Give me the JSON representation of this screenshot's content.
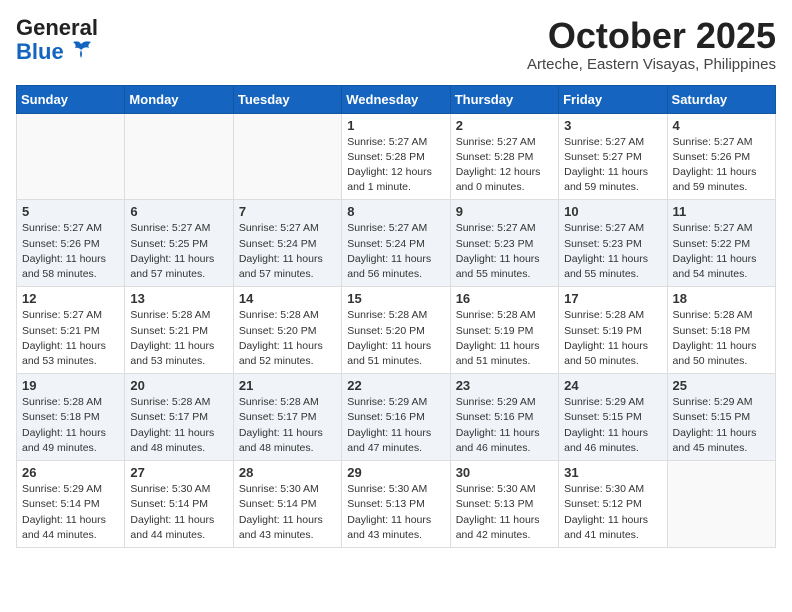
{
  "header": {
    "logo_general": "General",
    "logo_blue": "Blue",
    "month": "October 2025",
    "location": "Arteche, Eastern Visayas, Philippines"
  },
  "weekdays": [
    "Sunday",
    "Monday",
    "Tuesday",
    "Wednesday",
    "Thursday",
    "Friday",
    "Saturday"
  ],
  "weeks": [
    [
      {
        "day": "",
        "info": ""
      },
      {
        "day": "",
        "info": ""
      },
      {
        "day": "",
        "info": ""
      },
      {
        "day": "1",
        "info": "Sunrise: 5:27 AM\nSunset: 5:28 PM\nDaylight: 12 hours\nand 1 minute."
      },
      {
        "day": "2",
        "info": "Sunrise: 5:27 AM\nSunset: 5:28 PM\nDaylight: 12 hours\nand 0 minutes."
      },
      {
        "day": "3",
        "info": "Sunrise: 5:27 AM\nSunset: 5:27 PM\nDaylight: 11 hours\nand 59 minutes."
      },
      {
        "day": "4",
        "info": "Sunrise: 5:27 AM\nSunset: 5:26 PM\nDaylight: 11 hours\nand 59 minutes."
      }
    ],
    [
      {
        "day": "5",
        "info": "Sunrise: 5:27 AM\nSunset: 5:26 PM\nDaylight: 11 hours\nand 58 minutes."
      },
      {
        "day": "6",
        "info": "Sunrise: 5:27 AM\nSunset: 5:25 PM\nDaylight: 11 hours\nand 57 minutes."
      },
      {
        "day": "7",
        "info": "Sunrise: 5:27 AM\nSunset: 5:24 PM\nDaylight: 11 hours\nand 57 minutes."
      },
      {
        "day": "8",
        "info": "Sunrise: 5:27 AM\nSunset: 5:24 PM\nDaylight: 11 hours\nand 56 minutes."
      },
      {
        "day": "9",
        "info": "Sunrise: 5:27 AM\nSunset: 5:23 PM\nDaylight: 11 hours\nand 55 minutes."
      },
      {
        "day": "10",
        "info": "Sunrise: 5:27 AM\nSunset: 5:23 PM\nDaylight: 11 hours\nand 55 minutes."
      },
      {
        "day": "11",
        "info": "Sunrise: 5:27 AM\nSunset: 5:22 PM\nDaylight: 11 hours\nand 54 minutes."
      }
    ],
    [
      {
        "day": "12",
        "info": "Sunrise: 5:27 AM\nSunset: 5:21 PM\nDaylight: 11 hours\nand 53 minutes."
      },
      {
        "day": "13",
        "info": "Sunrise: 5:28 AM\nSunset: 5:21 PM\nDaylight: 11 hours\nand 53 minutes."
      },
      {
        "day": "14",
        "info": "Sunrise: 5:28 AM\nSunset: 5:20 PM\nDaylight: 11 hours\nand 52 minutes."
      },
      {
        "day": "15",
        "info": "Sunrise: 5:28 AM\nSunset: 5:20 PM\nDaylight: 11 hours\nand 51 minutes."
      },
      {
        "day": "16",
        "info": "Sunrise: 5:28 AM\nSunset: 5:19 PM\nDaylight: 11 hours\nand 51 minutes."
      },
      {
        "day": "17",
        "info": "Sunrise: 5:28 AM\nSunset: 5:19 PM\nDaylight: 11 hours\nand 50 minutes."
      },
      {
        "day": "18",
        "info": "Sunrise: 5:28 AM\nSunset: 5:18 PM\nDaylight: 11 hours\nand 50 minutes."
      }
    ],
    [
      {
        "day": "19",
        "info": "Sunrise: 5:28 AM\nSunset: 5:18 PM\nDaylight: 11 hours\nand 49 minutes."
      },
      {
        "day": "20",
        "info": "Sunrise: 5:28 AM\nSunset: 5:17 PM\nDaylight: 11 hours\nand 48 minutes."
      },
      {
        "day": "21",
        "info": "Sunrise: 5:28 AM\nSunset: 5:17 PM\nDaylight: 11 hours\nand 48 minutes."
      },
      {
        "day": "22",
        "info": "Sunrise: 5:29 AM\nSunset: 5:16 PM\nDaylight: 11 hours\nand 47 minutes."
      },
      {
        "day": "23",
        "info": "Sunrise: 5:29 AM\nSunset: 5:16 PM\nDaylight: 11 hours\nand 46 minutes."
      },
      {
        "day": "24",
        "info": "Sunrise: 5:29 AM\nSunset: 5:15 PM\nDaylight: 11 hours\nand 46 minutes."
      },
      {
        "day": "25",
        "info": "Sunrise: 5:29 AM\nSunset: 5:15 PM\nDaylight: 11 hours\nand 45 minutes."
      }
    ],
    [
      {
        "day": "26",
        "info": "Sunrise: 5:29 AM\nSunset: 5:14 PM\nDaylight: 11 hours\nand 44 minutes."
      },
      {
        "day": "27",
        "info": "Sunrise: 5:30 AM\nSunset: 5:14 PM\nDaylight: 11 hours\nand 44 minutes."
      },
      {
        "day": "28",
        "info": "Sunrise: 5:30 AM\nSunset: 5:14 PM\nDaylight: 11 hours\nand 43 minutes."
      },
      {
        "day": "29",
        "info": "Sunrise: 5:30 AM\nSunset: 5:13 PM\nDaylight: 11 hours\nand 43 minutes."
      },
      {
        "day": "30",
        "info": "Sunrise: 5:30 AM\nSunset: 5:13 PM\nDaylight: 11 hours\nand 42 minutes."
      },
      {
        "day": "31",
        "info": "Sunrise: 5:30 AM\nSunset: 5:12 PM\nDaylight: 11 hours\nand 41 minutes."
      },
      {
        "day": "",
        "info": ""
      }
    ]
  ]
}
